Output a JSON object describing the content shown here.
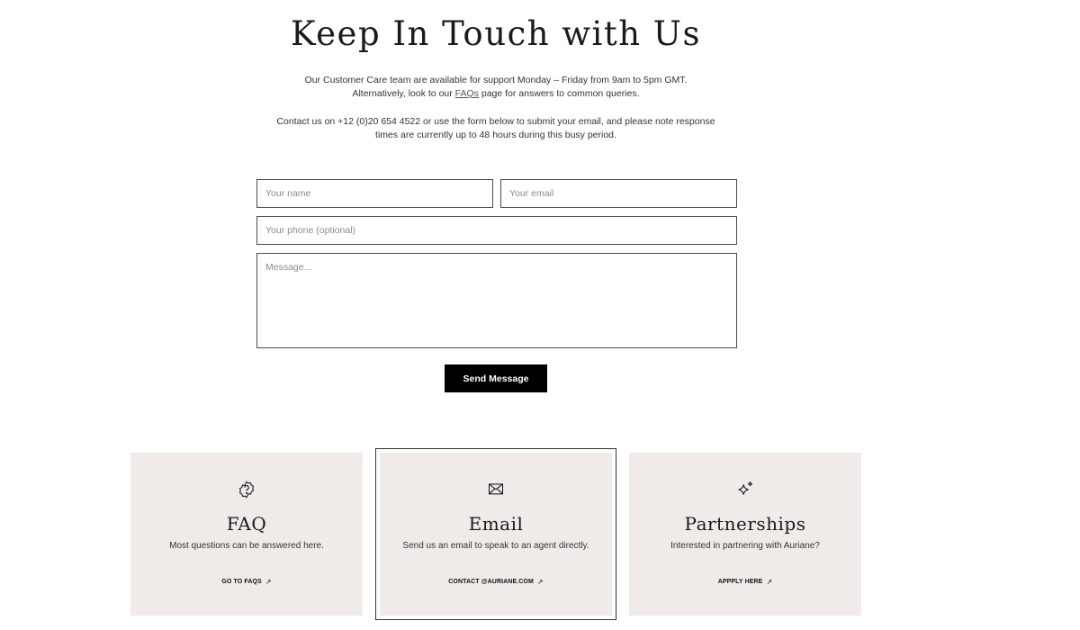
{
  "header": {
    "title": "Keep In Touch with Us"
  },
  "intro": {
    "line1": "Our Customer Care team are available for support Monday – Friday from 9am to 5pm GMT.",
    "line2_before": "Alternatively, look to our ",
    "faq_link": "FAQs",
    "line2_after": " page for answers to common queries.",
    "para2": "Contact us on +12 (0)20 654 4522 or use the form below to submit your email, and please note response times are currently up to 48 hours during this busy period."
  },
  "form": {
    "name_placeholder": "Your name",
    "email_placeholder": "Your email",
    "phone_placeholder": "Your phone (optional)",
    "message_placeholder": "Message...",
    "send_label": "Send Message"
  },
  "cards": [
    {
      "icon": "question-badge-icon",
      "title": "FAQ",
      "text": "Most questions can be answered here.",
      "link": "GO TO FAQS",
      "arrow": "↗"
    },
    {
      "icon": "envelope-icon",
      "title": "Email",
      "text": "Send us an email to speak to an agent directly.",
      "link": "CONTACT @AURIANE.COM",
      "arrow": "↗"
    },
    {
      "icon": "sparkle-icon",
      "title": "Partnerships",
      "text": "Interested in partnering with Auriane?",
      "link": "APPPLY HERE",
      "arrow": "↗"
    }
  ],
  "colors": {
    "card_bg": "#f0ebe8",
    "button_bg": "#000000",
    "field_border": "#4a4a4a"
  }
}
